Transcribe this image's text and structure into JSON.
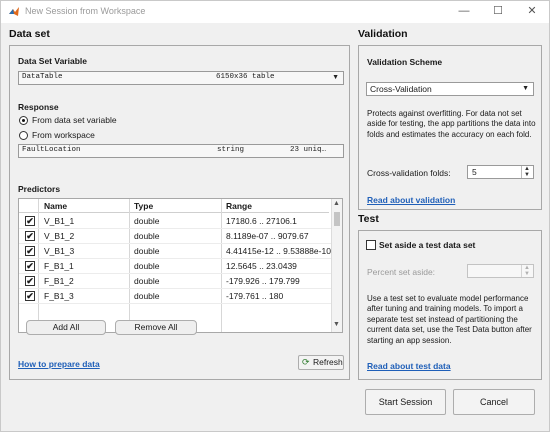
{
  "window": {
    "title": "New Session from Workspace",
    "controls": {
      "minimize": "—",
      "maximize": "☐",
      "close": "✕"
    }
  },
  "dataset": {
    "heading": "Data set",
    "variable": {
      "label": "Data Set Variable",
      "name": "DataTable",
      "info": "6150x36 table"
    },
    "response": {
      "label": "Response",
      "option_variable": "From data set variable",
      "option_workspace": "From workspace",
      "selected": "From data set variable",
      "name": "FaultLocation",
      "type": "string",
      "info": "23 uniq…"
    },
    "predictors": {
      "label": "Predictors",
      "columns": [
        "Name",
        "Type",
        "Range"
      ],
      "rows": [
        {
          "checked": "✔",
          "name": "V_B1_1",
          "type": "double",
          "range": "17180.6 .. 27106.1"
        },
        {
          "checked": "✔",
          "name": "V_B1_2",
          "type": "double",
          "range": "8.1189e-07 .. 9079.67"
        },
        {
          "checked": "✔",
          "name": "V_B1_3",
          "type": "double",
          "range": "4.41415e-12 .. 9.53888e-10"
        },
        {
          "checked": "✔",
          "name": "F_B1_1",
          "type": "double",
          "range": "12.5645 .. 23.0439"
        },
        {
          "checked": "✔",
          "name": "F_B1_2",
          "type": "double",
          "range": "-179.926 .. 179.799"
        },
        {
          "checked": "✔",
          "name": "F_B1_3",
          "type": "double",
          "range": "-179.761 .. 180"
        }
      ]
    },
    "add_all": "Add All",
    "remove_all": "Remove All",
    "how_to_link": "How to prepare data",
    "refresh": "Refresh"
  },
  "validation": {
    "heading": "Validation",
    "scheme_label": "Validation Scheme",
    "scheme_value": "Cross-Validation",
    "description": "Protects against overfitting. For data not set aside for testing, the app partitions the data into folds and estimates the accuracy on each fold.",
    "folds_label": "Cross-validation folds:",
    "folds_value": "5",
    "read_more": "Read about validation"
  },
  "test": {
    "heading": "Test",
    "checkbox_label": "Set aside a test data set",
    "percent_label": "Percent set aside:",
    "percent_value": "",
    "description": "Use a test set to evaluate model performance after tuning and training models. To import a separate test set instead of partitioning the current data set, use the Test Data button after starting an app session.",
    "read_more": "Read about test data"
  },
  "footer": {
    "start": "Start Session",
    "cancel": "Cancel"
  },
  "icons": {
    "app": "matlab-logo-icon",
    "refresh": "refresh-icon"
  }
}
